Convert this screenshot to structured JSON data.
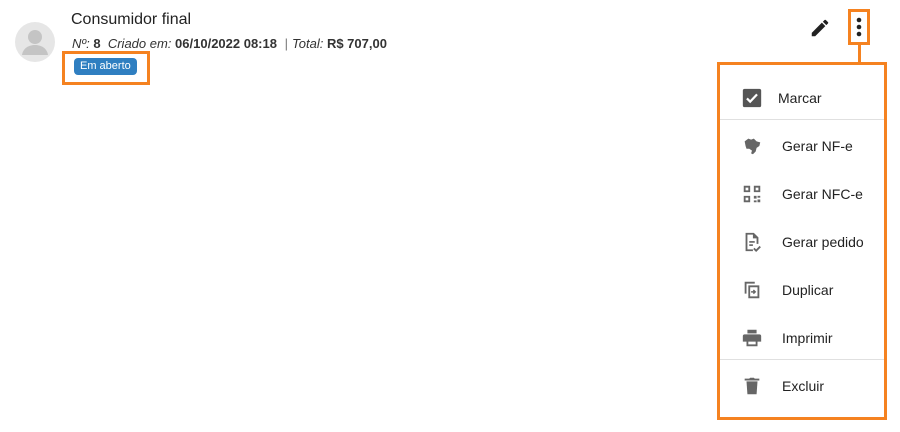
{
  "order": {
    "customer_name": "Consumidor final",
    "number_label": "Nº:",
    "number_value": "8",
    "created_label": "Criado em:",
    "created_value": "06/10/2022 08:18",
    "separator": "|",
    "total_label": "Total:",
    "total_value": "R$ 707,00",
    "status": "Em aberto"
  },
  "icons": {
    "avatar": "person-icon",
    "edit": "pencil-icon",
    "more": "more-vertical-icon"
  },
  "menu": {
    "items": [
      {
        "label": "Marcar",
        "icon": "checkbox-checked-icon"
      },
      {
        "label": "Gerar NF-e",
        "icon": "brazil-map-icon"
      },
      {
        "label": "Gerar NFC-e",
        "icon": "qr-code-icon"
      },
      {
        "label": "Gerar pedido",
        "icon": "document-check-icon"
      },
      {
        "label": "Duplicar",
        "icon": "duplicate-icon"
      },
      {
        "label": "Imprimir",
        "icon": "printer-icon"
      },
      {
        "label": "Excluir",
        "icon": "trash-icon"
      }
    ]
  },
  "colors": {
    "highlight": "#f58220",
    "status_badge": "#2f7fc1",
    "icon_gray": "#666666",
    "avatar_bg": "#e6e6e6"
  }
}
